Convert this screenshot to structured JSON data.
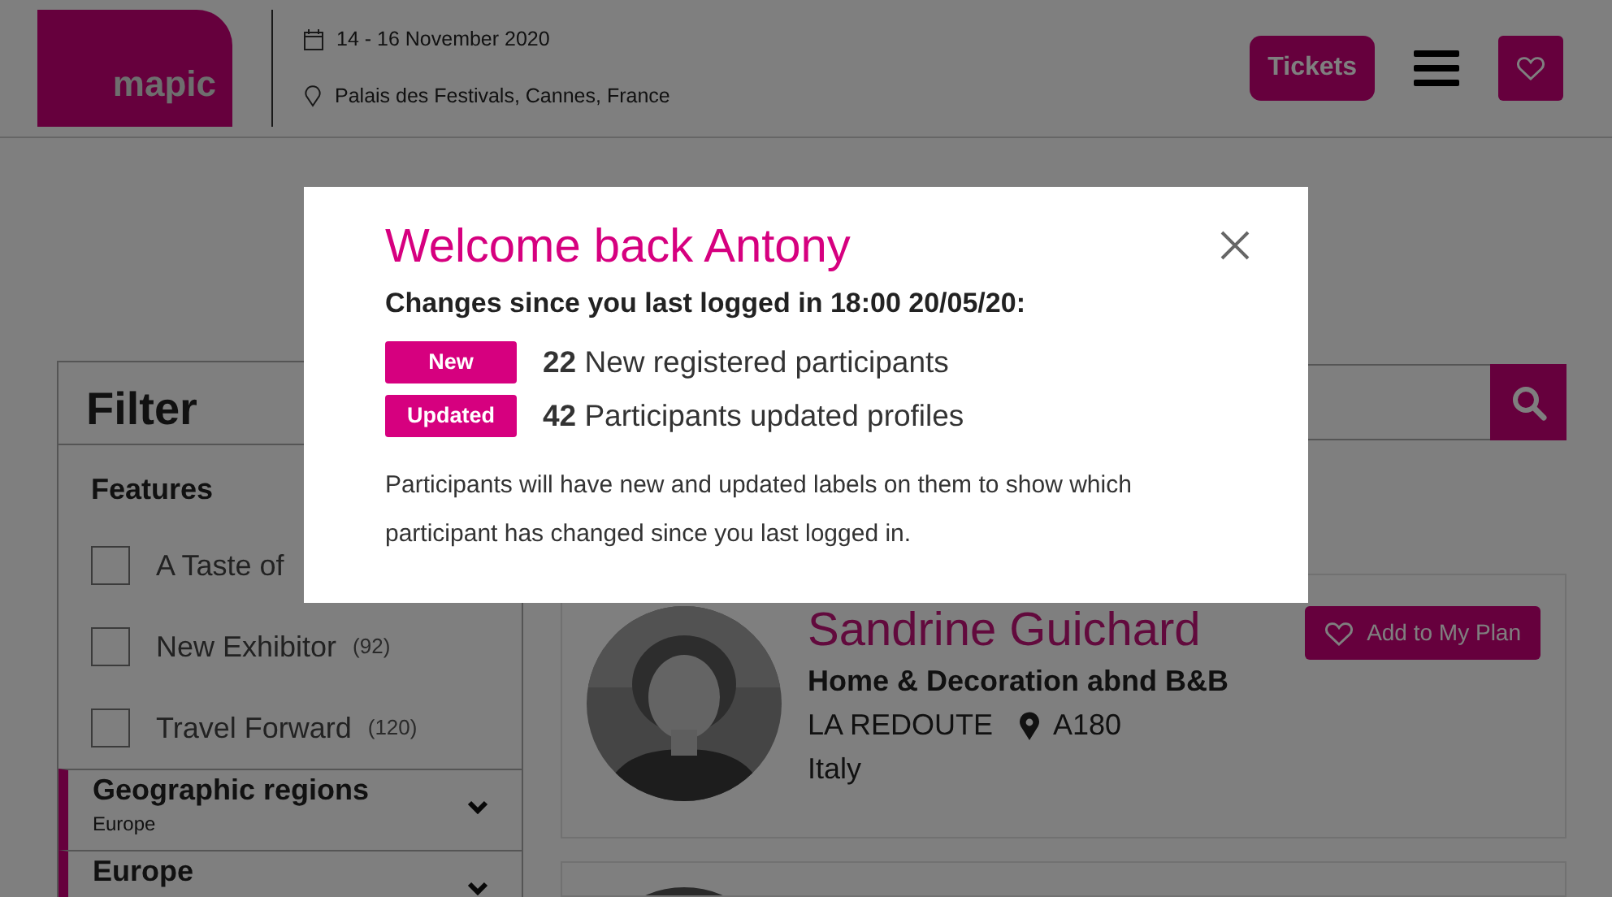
{
  "header": {
    "logo": "mapic",
    "date": "14 - 16 November 2020",
    "venue": "Palais des Festivals, Cannes, France",
    "tickets_button": "Tickets"
  },
  "filter": {
    "title": "Filter",
    "section": "Features",
    "options": [
      {
        "label": "A Taste of",
        "checked": false
      },
      {
        "label": "New Exhibitor",
        "count": "(92)",
        "checked": false
      },
      {
        "label": "Travel Forward",
        "count": "(120)",
        "checked": false
      }
    ],
    "groups": [
      {
        "title": "Geographic regions",
        "subtitle": "Europe",
        "expanded": false,
        "active": true
      },
      {
        "title": "Europe",
        "expanded": false,
        "active": true
      }
    ]
  },
  "results": [
    {
      "kind": "full",
      "name": "Sandrine Guichard",
      "category": "Home & Decoration abnd B&B",
      "company": "LA REDOUTE",
      "stand": "A180",
      "country": "Italy",
      "action": "Add to My Plan"
    },
    {
      "kind": "partial"
    }
  ],
  "modal": {
    "title": "Welcome back Antony",
    "subtitle": "Changes since you last logged in 18:00 20/05/20:",
    "changes": [
      {
        "tag": "New",
        "count": "22",
        "text": "New registered participants"
      },
      {
        "tag": "Updated",
        "count": "42",
        "text": "Participants updated profiles"
      }
    ],
    "note": "Participants will have new and updated labels on them to show which participant has changed since you last logged in."
  }
}
